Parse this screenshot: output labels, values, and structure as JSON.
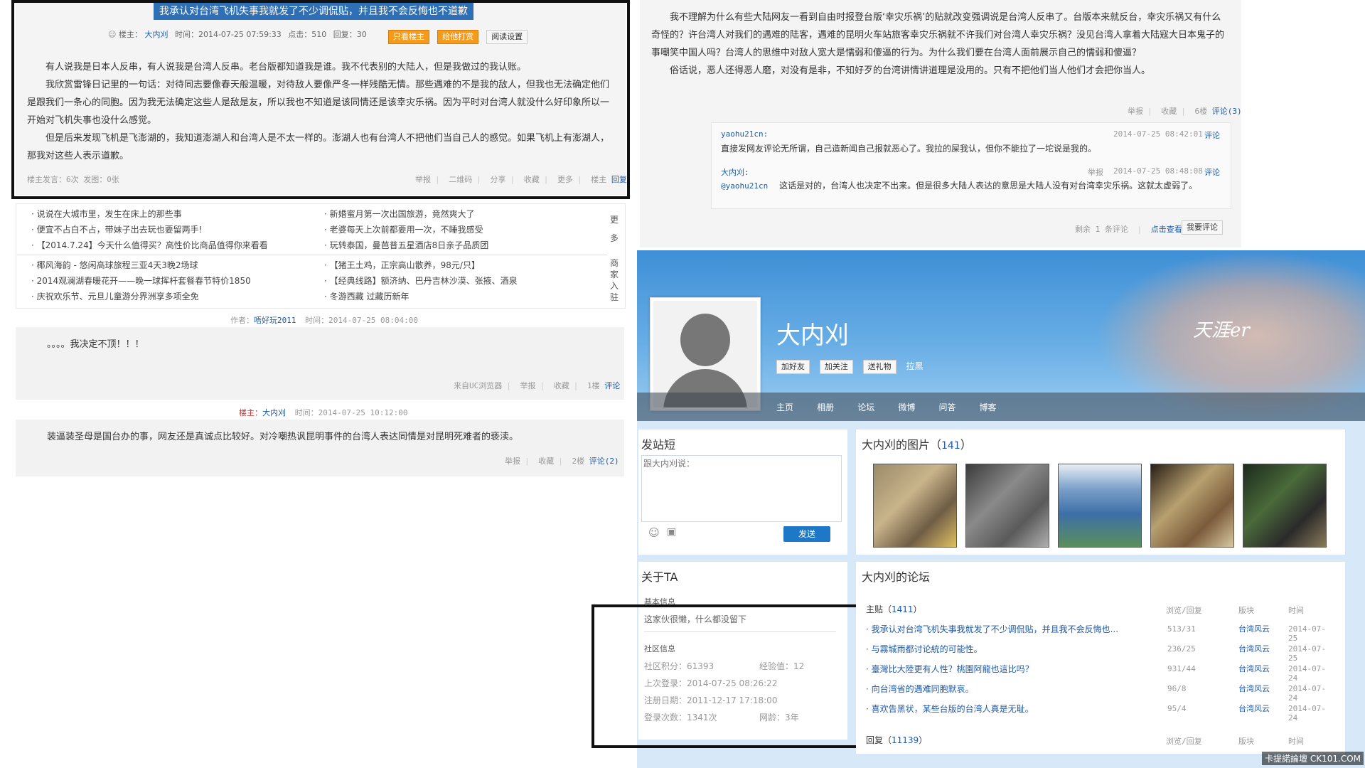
{
  "left_post": {
    "title": "我承认对台湾飞机失事我就发了不少调侃贴，并且我不会反悔也不道歉",
    "meta": {
      "author_label": "楼主：",
      "author": "大内刈",
      "time": "时间：2014-07-25 07:59:33",
      "clicks": "点击：510",
      "replies": "回复：30"
    },
    "buttons": {
      "only_author": "只看楼主",
      "tip": "给他打赏",
      "read_settings": "阅读设置"
    },
    "paragraphs": [
      "有人说我是日本人反串，有人说我是台湾人反串。老台版都知道我是谁。我不代表别的大陆人，但是我做过的我认账。",
      "我欣赏雷锋日记里的一句话：对待同志要像春天般温暖，对待敌人要像严冬一样残酷无情。那些遇难的不是我的敌人，但我也无法确定他们是跟我们一条心的同胞。因为我无法确定这些人是敌是友，所以我也不知道是该同情还是该幸灾乐祸。因为平时对台湾人就没什么好印象所以一开始对飞机失事也没什么感觉。",
      "但是后来发现飞机是飞澎湖的，我知道澎湖人和台湾人是不太一样的。澎湖人也有台湾人不把他们当自己人的感觉。如果飞机上有澎湖人，那我对这些人表示道歉。"
    ],
    "footer_left": "楼主发言：6次 发图：0张",
    "footer_actions": [
      "举报",
      "二维码",
      "分享",
      "收藏",
      "更多",
      "楼主"
    ],
    "reply_link": "回复"
  },
  "ads": {
    "col1": [
      "· 说说在大城市里，发生在床上的那些事",
      "· 便宜不占白不占，带妹子出去玩也要留两手!",
      "· 【2014.7.24】今天什么值得买？高性价比商品值得你来看看"
    ],
    "col2": [
      "· 新婚蜜月第一次出国旅游，竟然爽大了",
      "· 老婆每天上次前都要用一次，不睡我感受",
      "· 玩转泰国，曼芭普五星酒店8日亲子品质团"
    ],
    "col3": [
      "· 椰风海韵 - 悠闲高球旅程三亚4天3晚2场球",
      "· 2014观澜湖春暖花开——晚一球挥杆套餐春节特价1850",
      "· 庆祝欢乐节、元旦儿童游分界洲享多项全免"
    ],
    "col4": [
      "· 【猪王土鸡，正宗高山散养，98元/只】",
      "· 【经典线路】额济纳、巴丹吉林沙漠、张掖、酒泉",
      "· 冬游西藏 过藏历新年"
    ],
    "side_more": "更多",
    "side_merchant": "商家入驻"
  },
  "reply1": {
    "meta_author_label": "作者：",
    "author": "唔好玩2011",
    "time": "时间：2014-07-25 08:04:00",
    "text": "。。。。我决定不顶！！！",
    "footer": "来自UC浏览器",
    "actions": [
      "举报",
      "收藏",
      "1楼"
    ],
    "comment": "评论"
  },
  "reply2": {
    "meta_author_label": "楼主：",
    "author": "大内刈",
    "time": "时间：2014-07-25 10:12:00",
    "text": "装逼装圣母是国台办的事，网友还是真诚点比较好。对冷嘲热讽昆明事件的台湾人表达同情是对昆明死难者的亵渎。",
    "actions": [
      "举报",
      "收藏",
      "2楼"
    ],
    "comment": "评论(2)"
  },
  "right_post": {
    "paragraphs": [
      "我不理解为什么有些大陆网友一看到自由时报登台版‘幸灾乐祸’的贴就改变强调说是台湾人反串了。台版本来就反台，幸灾乐祸又有什么奇怪的？许台湾人对我们的遇难的陆客，遇难的昆明火车站旅客幸灾乐祸就不许我们对台湾人幸灾乐祸？没见台湾人拿着大陆寇大日本鬼子的事嘲笑中国人吗？台湾人的思维中对敌人宽大是懦弱和傻逼的行为。为什么我们要在台湾人面前展示自己的懦弱和傻逼？",
      "俗话说，恶人还得恶人磨，对没有是非，不知好歹的台湾讲情讲道理是没用的。只有不把他们当人他们才会把你当人。"
    ],
    "actions": [
      "举报",
      "收藏",
      "6楼"
    ],
    "comment": "评论(3)",
    "comments": [
      {
        "user": "yaohu21cn:",
        "time": "2014-07-25 08:42:01",
        "action": "评论",
        "text": "直接发网友评论无所谓，自己造新闻自己报就恶心了。我拉的屎我认，但你不能拉了一坨说是我的。"
      },
      {
        "user": "大内刈:",
        "report": "举报",
        "time": "2014-07-25 08:48:08",
        "action": "评论",
        "mention": "@yaohu21cn",
        "text": "这话是对的，台湾人也决定不出来。但是很多大陆人表达的意思是大陆人没有对台湾幸灾乐祸。这就太虚弱了。"
      }
    ],
    "remaining": "剩余 1 条评论",
    "view": "点击查看",
    "want_comment": "我要评论"
  },
  "profile": {
    "name": "大内刈",
    "buttons": [
      "加好友",
      "加关注",
      "送礼物",
      "拉黑"
    ],
    "nav": [
      "主页",
      "相册",
      "论坛",
      "微博",
      "问答",
      "博客"
    ],
    "brand": "天涯er",
    "post_short": {
      "title": "发站短",
      "placeholder": "跟大内刈说：",
      "send": "发送"
    },
    "photos": {
      "title": "大内刈的图片（",
      "count": "141",
      "close": "）"
    },
    "about": {
      "title": "关于TA",
      "basic": "基本信息",
      "intro": "这家伙很懒，什么都没留下",
      "community": "社区信息",
      "points": "社区积分：61393",
      "exp": "经验值：12",
      "last_login": "上次登录：2014-07-25 08:26:22",
      "register": "注册日期：2011-12-17 17:18:00",
      "logins": "登录次数：1341次",
      "age": "网龄：3年"
    },
    "forum": {
      "title": "大内刈的论坛",
      "topics_label": "主贴（",
      "topics_count": "1411",
      "topics_close": "）",
      "cols": [
        "浏览/回复",
        "版块",
        "时间"
      ],
      "rows": [
        {
          "title": "· 我承认对台湾飞机失事我就发了不少调侃贴，并且我不会反悔也...",
          "stat": "513/31",
          "board": "台湾风云",
          "date": "2014-07-25"
        },
        {
          "title": "· 与霧城雨都讨论統的可能性。",
          "stat": "236/25",
          "board": "台湾风云",
          "date": "2014-07-25"
        },
        {
          "title": "· 臺灣比大陸更有人性？桃園阿龍也這比吗？",
          "stat": "931/44",
          "board": "台湾风云",
          "date": "2014-07-24"
        },
        {
          "title": "· 向台湾省的遇难同胞默哀。",
          "stat": "96/8",
          "board": "台湾风云",
          "date": "2014-07-24"
        },
        {
          "title": "· 喜欢告黑状，某些台版的台湾人真是无耻。",
          "stat": "95/4",
          "board": "台湾风云",
          "date": "2014-07-24"
        }
      ],
      "replies_label": "回复（",
      "replies_count": "11139",
      "replies_close": "）"
    }
  },
  "watermark": "卡提諾論壇 CK101.COM"
}
